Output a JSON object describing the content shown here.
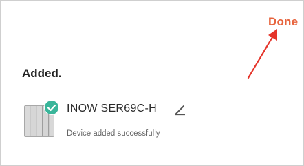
{
  "header": {
    "done_label": "Done"
  },
  "section": {
    "title": "Added."
  },
  "device": {
    "name": "INOW SER69C-H",
    "status": "Device added successfully",
    "image_icon": "radiator-icon",
    "badge_icon": "checkmark-circle-icon",
    "edit_icon": "pencil-icon"
  },
  "colors": {
    "accent": "#e7633c",
    "arrow": "#e5342a",
    "check_badge": "#3ab59a",
    "text_primary": "#222222",
    "text_secondary": "#666666"
  }
}
